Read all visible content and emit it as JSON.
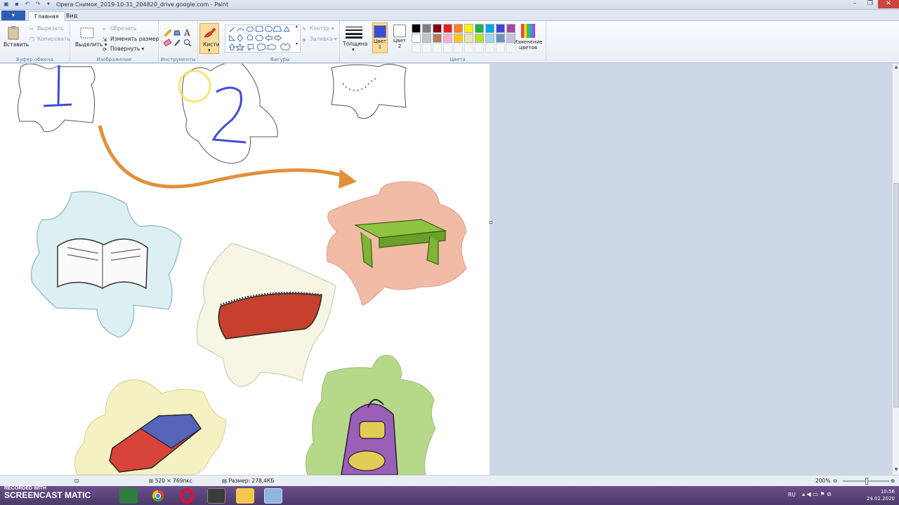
{
  "window": {
    "title": "Opera Снимок_2019-10-31_204820_drive.google.com - Paint",
    "controls": {
      "minimize": "–",
      "maximize": "❐",
      "close": "✕"
    }
  },
  "tabs": {
    "file": "▾",
    "home": "Главная",
    "view": "Вид"
  },
  "ribbon": {
    "clipboard": {
      "paste": "Вставить",
      "cut": "Вырезать",
      "copy": "Копировать",
      "label": "Буфер обмена"
    },
    "image": {
      "select": "Выделить",
      "crop": "Обрезать",
      "resize": "Изменить размер",
      "rotate": "Повернуть",
      "label": "Изображение"
    },
    "tools": {
      "label": "Инструменты"
    },
    "brushes": {
      "label": "Кисти"
    },
    "shapes": {
      "outline": "Контур",
      "fill": "Заливка",
      "label": "Фигуры"
    },
    "thickness": {
      "label": "Толщина"
    },
    "colors": {
      "color1": "Цвет 1",
      "color2": "Цвет 2",
      "edit": "Изменение цветов",
      "label": "Цвета",
      "color1_value": "#3d4cd6",
      "color2_value": "#ffffff",
      "palette": [
        "#000000",
        "#7f7f7f",
        "#880015",
        "#ed1c24",
        "#ff7f27",
        "#fff200",
        "#22b14c",
        "#00a2e8",
        "#3f48cc",
        "#a349a4",
        "#ffffff",
        "#c3c3c3",
        "#b97a57",
        "#ffaec9",
        "#ffc90e",
        "#efe4b0",
        "#b5e61d",
        "#99d9ea",
        "#7092be",
        "#c8bfe7"
      ]
    }
  },
  "status": {
    "dimensions": "520 × 769пкс",
    "size": "Размер: 278,4КБ",
    "zoom": "200%"
  },
  "taskbar": {
    "watermark_small": "RECORDED WITH",
    "watermark_brand": "SCREENCAST",
    "watermark_brand2": "MATIC",
    "lang": "RU",
    "time": "10:56",
    "date": "24.02.2020"
  }
}
